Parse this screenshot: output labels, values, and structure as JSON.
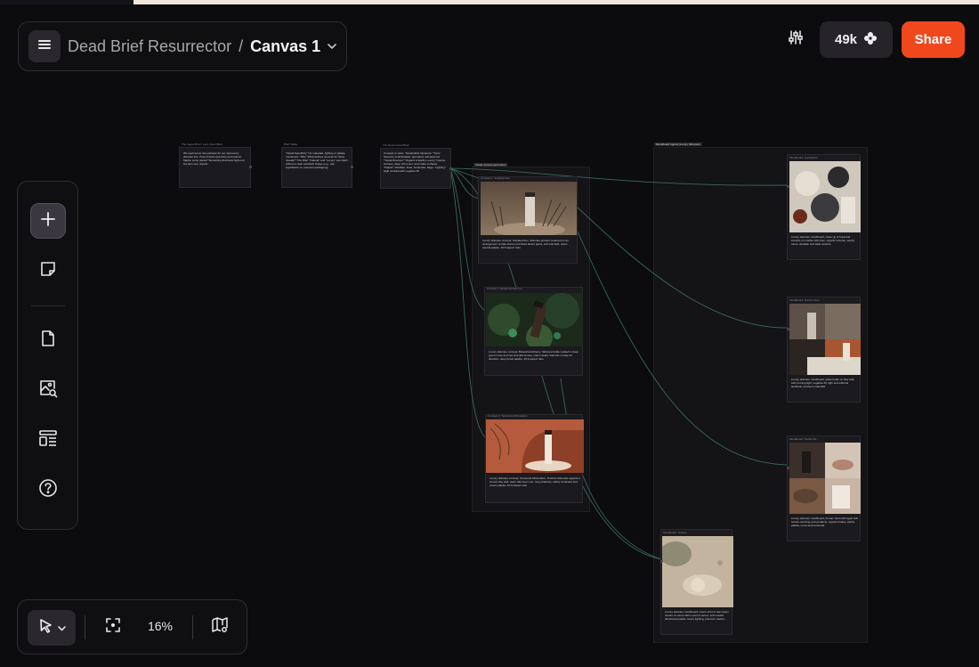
{
  "header": {
    "project_name": "Dead Brief Resurrector",
    "separator": "/",
    "canvas_name": "Canvas 1",
    "credits": "49k",
    "share_label": "Share"
  },
  "bottombar": {
    "zoom": "16%"
  },
  "icons": {
    "menu": "hamburger-icon",
    "canvas_dropdown": "chevron-down-icon",
    "settings": "sliders-icon",
    "credits": "flower-icon",
    "add": "plus-icon",
    "sticky": "sticky-note-icon",
    "document": "document-icon",
    "image_search": "image-search-icon",
    "template": "template-icon",
    "help": "help-icon",
    "pointer": "cursor-icon",
    "fit": "fit-screen-icon",
    "minimap": "map-icon"
  },
  "colors": {
    "accent": "#f1471d",
    "background": "#0c0b0d",
    "edge": "#3e7a6a"
  },
  "canvas": {
    "groups": [
      {
        "label": "Moodboard Agents (Luxury Skincare)"
      },
      {
        "label": "Visual concept generation"
      }
    ],
    "nodes": [
      {
        "title": "The Vague Brief / Lazy Client Brief",
        "text": "We need some nice pictures for our new luxury skincare line. Kind of dark expensive and natural. Maybe some plants? Something that feels high-end but also very organic."
      },
      {
        "title": "Brief Intake",
        "text": "\"Visual Specificity\" No materials, lighting or palette mentioned. \"Why\" What defines success for these visuals?  \"The Risk\" \"Natural\" and \"Luxury\" can clash without a clear aesthetic bridge (e.g., raw ingredients vs. premium packaging)."
      },
      {
        "title": "The Resurrected Brief",
        "text": "Concept to solve: 'Sustainable Opulence' \"Tone\" Serenely sophisticated, grounded, self-assured. \"Visual Direction\" \"Organic & Earthy Luxury\" Intense textures, deep rich tones, and matte surfaces. \"Palette\" Obsidian, Rust, Terracotta, Sage. \"Lighting\" High contrast with negative fill."
      },
      {
        "title": "Concept 1: Sculpted Zen",
        "badge": "Auto",
        "text": "Luxury skincare concept: Sculpted Zen. Skincare product centered on an arrangement of pale stones and dried desert grass, soft side light, warm neutral palette, 16:9 aspect ratio"
      },
      {
        "title": "Concept 2: Botanical Alchemy",
        "badge": "GPT Image 1 (Medium)",
        "text": "Luxury skincare concept: Botanical Alchemy. Skincare bottle nestled in deep green moss and raw emerald stones, macro detail, dramatic moody art direction, deep forest palette, 16:9 aspect ratio"
      },
      {
        "title": "Concept 3: Terracotta Minimalism",
        "badge": "Auto",
        "text": "Luxury skincare concept: Terracotta Minimalism. Product silhouette against a curved clay wall, warm afternoon sun, long shadows, earthy terracotta and cream palette, 16:9 aspect ratio"
      },
      {
        "title": "Moodboard: Ingredients",
        "badge": "Auto",
        "text": "Luxury skincare moodboard, close-up of botanical extracts on marble with linen, organic textures, earthy tones, obsidian and slate accents"
      },
      {
        "title": "Moodboard: Environment",
        "badge": "Auto",
        "text": "Luxury skincare moodboard, glass bottle on clay wall, soft morning light, negative fill, high end editorial aesthetic, premium materials"
      },
      {
        "title": "Moodboard: Tactile Flu...",
        "badge": "GPT Image 1 (Medium)",
        "text": "Luxury skincare moodboard, human hand with aged skin texture touching cool products, organic botany, earthy palette, moss and terracotta"
      },
      {
        "title": "Moodboard: Texture",
        "badge": "GPT Image 1 (Medium)",
        "text": "Luxury skincare moodboard, macro shot of raw cream texture on stone with a pool of serum, soft natural directional palette, luxury lighting, premium realism"
      }
    ]
  }
}
